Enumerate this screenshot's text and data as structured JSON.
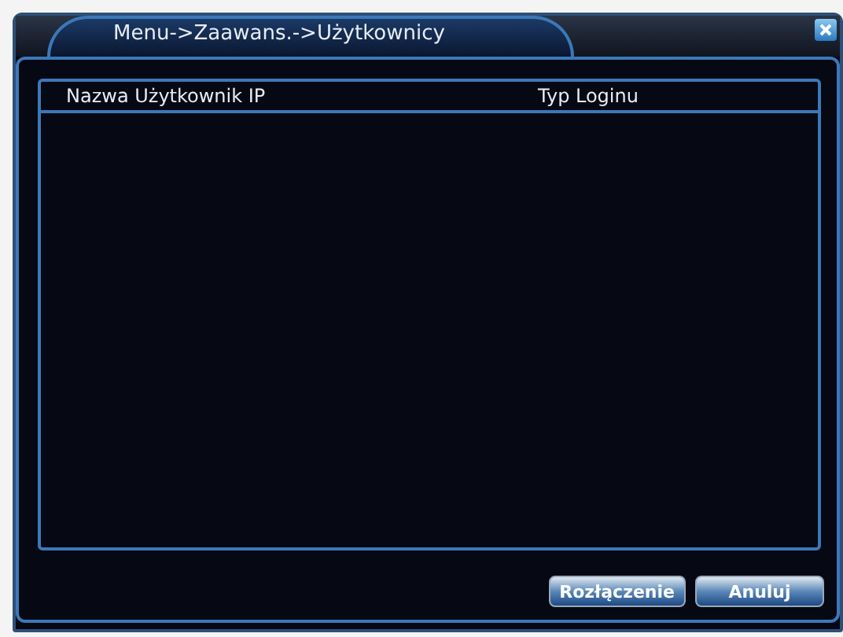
{
  "window": {
    "title": "Menu->Zaawans.->Użytkownicy"
  },
  "table": {
    "columns": [
      "Nazwa Użytkownik IP",
      "Typ Loginu"
    ]
  },
  "buttons": [
    "Rozłączenie",
    "Anuluj"
  ]
}
